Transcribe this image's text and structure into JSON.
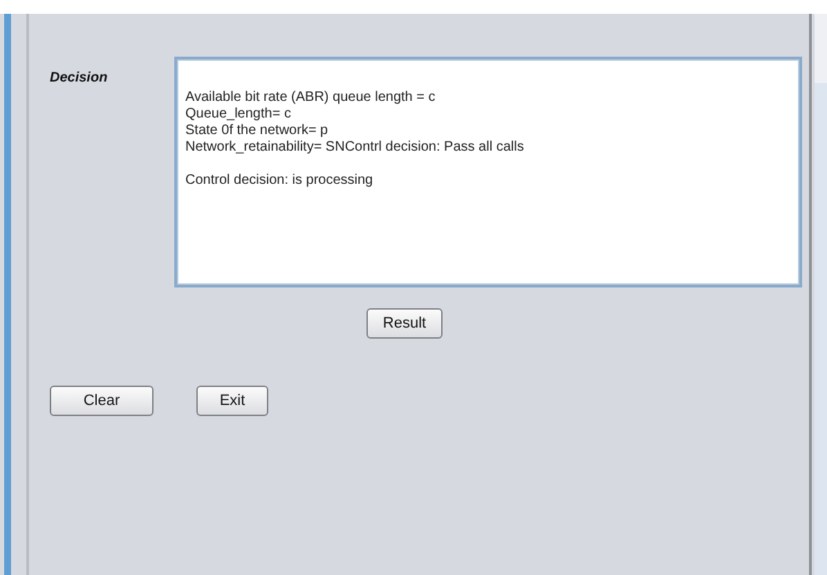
{
  "decision": {
    "label": "Decision",
    "output": [
      [
        "Available bit rate (ABR) queue length = c",
        "Queue_length= c",
        "State 0f the network= p",
        "Network_retainability= SNContrl decision: Pass all calls"
      ],
      [
        "Control decision: is processing"
      ]
    ]
  },
  "result_button": "Result",
  "buttons": [
    "Clear",
    "Exit"
  ]
}
